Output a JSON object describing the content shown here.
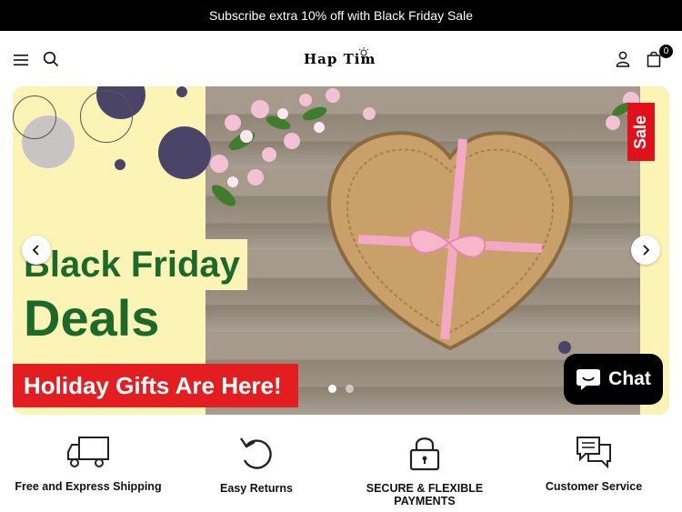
{
  "announcement": {
    "text": "Subscribe extra 10% off with Black Friday Sale"
  },
  "header": {
    "logo_text": "Hap Tim",
    "cart_count": "0"
  },
  "hero": {
    "line1": "Black Friday",
    "line2": "Deals",
    "banner": "Holiday Gifts Are Here!",
    "sale_tag": "Sale",
    "active_slide": 1,
    "slide_count": 2
  },
  "chat": {
    "label": "Chat"
  },
  "features": [
    {
      "label": "Free and Express Shipping",
      "icon": "truck-icon"
    },
    {
      "label": "Easy Returns",
      "icon": "undo-icon"
    },
    {
      "label": "SECURE & FLEXIBLE PAYMENTS",
      "icon": "lock-icon"
    },
    {
      "label": "Customer Service",
      "icon": "chat-bubbles-icon"
    }
  ],
  "colors": {
    "deal_green": "#1b6a2c",
    "banner_red": "#e41e20",
    "panel_yellow": "#fbf4b5"
  }
}
